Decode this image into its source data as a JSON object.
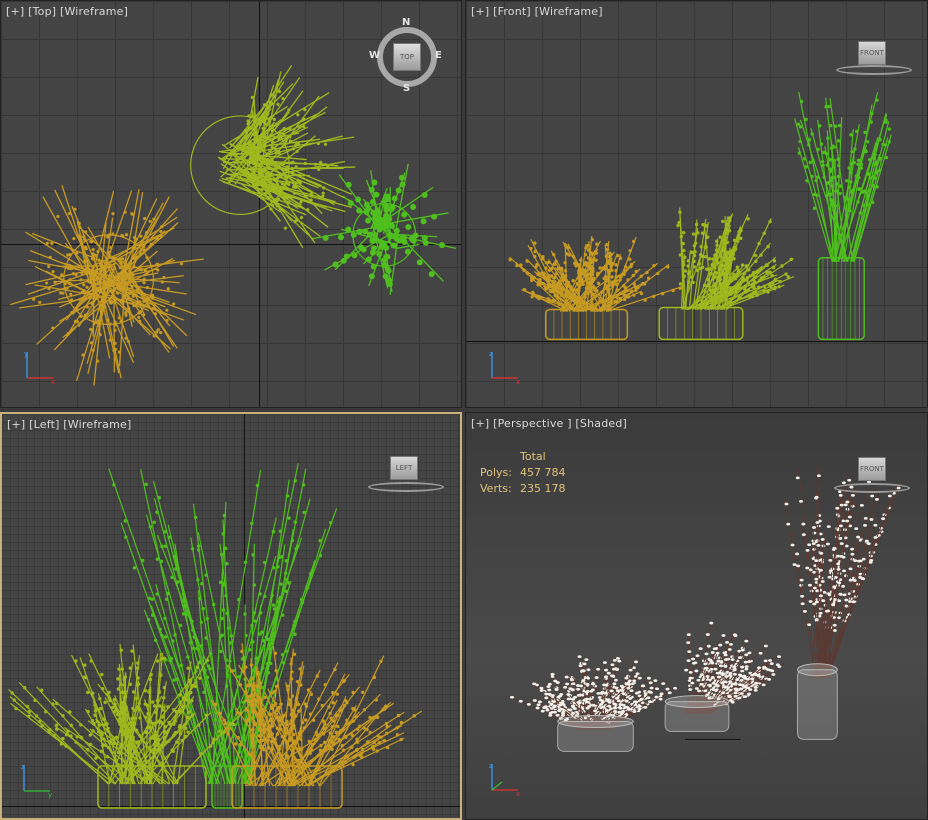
{
  "viewports": {
    "top": {
      "plus": "[+]",
      "view": "[Top]",
      "mode": "[Wireframe]"
    },
    "front": {
      "plus": "[+]",
      "view": "[Front]",
      "mode": "[Wireframe]"
    },
    "left": {
      "plus": "[+]",
      "view": "[Left]",
      "mode": "[Wireframe]"
    },
    "perspective": {
      "plus": "[+]",
      "view": "[Perspective ]",
      "mode": "[Shaded]"
    }
  },
  "stats": {
    "header": "Total",
    "polys_label": "Polys:",
    "polys_value": "457 784",
    "verts_label": "Verts:",
    "verts_value": "235 178"
  },
  "viewcube": {
    "top_face": "TOP",
    "front_face": "FRONT",
    "left_face": "LEFT",
    "north": "N",
    "south": "S",
    "east": "E",
    "west": "W"
  },
  "colors": {
    "orange_plant": "#c79a22",
    "yellowgreen_plant": "#9fb81e",
    "green_plant": "#4fbf1e",
    "selected_border": "#c8b27a",
    "stats_text": "#e2c27a"
  },
  "icons": {
    "viewcube": "viewcube-icon",
    "compass": "compass-icon",
    "axis_gizmo": "axis-gizmo-icon"
  }
}
